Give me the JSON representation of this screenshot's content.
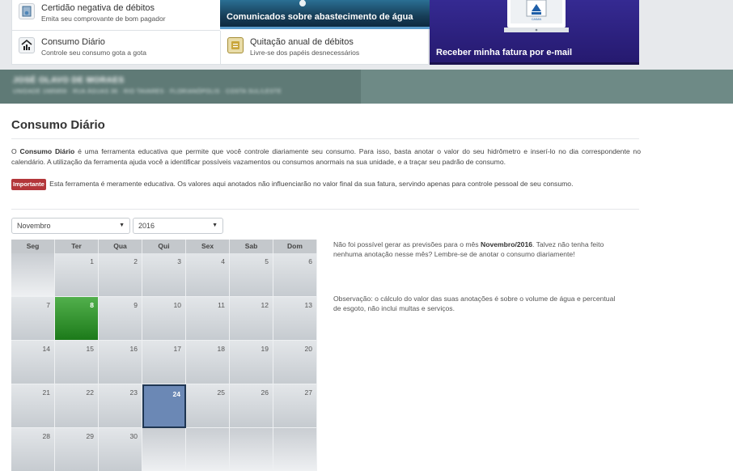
{
  "services": {
    "certidao": {
      "title": "Certidão negativa de débitos",
      "subtitle": "Emita seu comprovante de bom pagador"
    },
    "consumo": {
      "title": "Consumo Diário",
      "subtitle": "Controle seu consumo gota a gota"
    },
    "quitacao": {
      "title": "Quitação anual de débitos",
      "subtitle": "Livre-se dos papéis desnecessários"
    }
  },
  "banners": {
    "comunicados": "Comunicados sobre abastecimento de água",
    "fatura": "Receber minha fatura por e-mail",
    "fatura_logo": "CASAN"
  },
  "customer": {
    "name": "JOSÉ OLAVO DE MORAES",
    "address": "UNIDADE 1685859 · RUA ÁGUAS 36 · RIO TAVARES · FLORIANÓPOLIS · COSTA SUL/LESTE"
  },
  "page": {
    "title": "Consumo Diário",
    "intro_prefix": "O ",
    "intro_bold": "Consumo Diário",
    "intro_text": " é uma ferramenta educativa que permite que você controle diariamente seu consumo. Para isso, basta anotar o valor do seu hidrômetro e inserí-lo no dia correspondente no calendário. A utilização da ferramenta ajuda você a identificar possíveis vazamentos ou consumos anormais na sua unidade, e a traçar seu padrão de consumo.",
    "important_badge": "Importante",
    "important_text": " Esta ferramenta é meramente educativa. Os valores aqui anotados não influenciarão no valor final da sua fatura, servindo apenas para controle pessoal de seu consumo."
  },
  "filters": {
    "month": "Novembro",
    "year": "2016"
  },
  "calendar": {
    "weekdays": [
      "Seg",
      "Ter",
      "Qua",
      "Qui",
      "Sex",
      "Sab",
      "Dom"
    ],
    "leading_blanks": 1,
    "days_in_month": 30,
    "marked_days": [
      8
    ],
    "selected_day": 24
  },
  "notes": {
    "forecast_prefix": "Não foi possível gerar as previsões para o mês ",
    "forecast_bold": "Novembro/2016",
    "forecast_suffix": ". Talvez não tenha feito nenhuma anotação nesse mês? Lembre-se de anotar o consumo diariamente!",
    "observation": "Observação: o cálculo do valor das suas anotações é sobre o volume de água e percentual de esgoto, não inclui multas e serviços."
  }
}
